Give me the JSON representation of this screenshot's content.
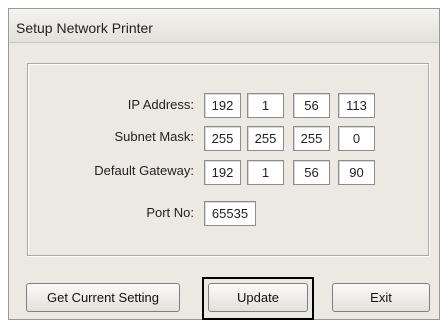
{
  "window": {
    "title": "Setup Network Printer"
  },
  "fields": {
    "ip_address": {
      "label": "IP Address:",
      "octets": [
        "192",
        "1",
        "56",
        "113"
      ]
    },
    "subnet_mask": {
      "label": "Subnet Mask:",
      "octets": [
        "255",
        "255",
        "255",
        "0"
      ]
    },
    "default_gateway": {
      "label": "Default Gateway:",
      "octets": [
        "192",
        "1",
        "56",
        "90"
      ]
    },
    "port": {
      "label": "Port No:",
      "value": "65535"
    }
  },
  "buttons": {
    "get_current_setting": "Get Current Setting",
    "update": "Update",
    "exit": "Exit"
  }
}
